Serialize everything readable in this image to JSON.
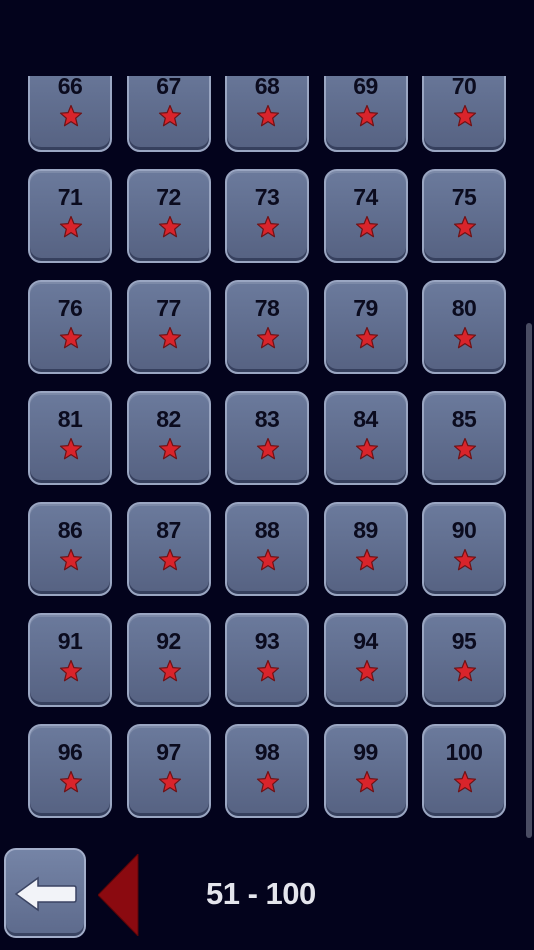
{
  "levels": [
    {
      "number": "66",
      "stars": 1
    },
    {
      "number": "67",
      "stars": 1
    },
    {
      "number": "68",
      "stars": 1
    },
    {
      "number": "69",
      "stars": 1
    },
    {
      "number": "70",
      "stars": 1
    },
    {
      "number": "71",
      "stars": 1
    },
    {
      "number": "72",
      "stars": 1
    },
    {
      "number": "73",
      "stars": 1
    },
    {
      "number": "74",
      "stars": 1
    },
    {
      "number": "75",
      "stars": 1
    },
    {
      "number": "76",
      "stars": 1
    },
    {
      "number": "77",
      "stars": 1
    },
    {
      "number": "78",
      "stars": 1
    },
    {
      "number": "79",
      "stars": 1
    },
    {
      "number": "80",
      "stars": 1
    },
    {
      "number": "81",
      "stars": 1
    },
    {
      "number": "82",
      "stars": 1
    },
    {
      "number": "83",
      "stars": 1
    },
    {
      "number": "84",
      "stars": 1
    },
    {
      "number": "85",
      "stars": 1
    },
    {
      "number": "86",
      "stars": 1
    },
    {
      "number": "87",
      "stars": 1
    },
    {
      "number": "88",
      "stars": 1
    },
    {
      "number": "89",
      "stars": 1
    },
    {
      "number": "90",
      "stars": 1
    },
    {
      "number": "91",
      "stars": 1
    },
    {
      "number": "92",
      "stars": 1
    },
    {
      "number": "93",
      "stars": 1
    },
    {
      "number": "94",
      "stars": 1
    },
    {
      "number": "95",
      "stars": 1
    },
    {
      "number": "96",
      "stars": 1
    },
    {
      "number": "97",
      "stars": 1
    },
    {
      "number": "98",
      "stars": 1
    },
    {
      "number": "99",
      "stars": 1
    },
    {
      "number": "100",
      "stars": 1
    }
  ],
  "footer": {
    "page_range": "51 - 100",
    "back_icon": "left-arrow-icon",
    "prev_icon": "triangle-left-icon"
  },
  "colors": {
    "background": "#03031c",
    "tile": "#616e90",
    "tile_border": "#9aa6c2",
    "star": "#d9242b",
    "star_outline": "#6e1216",
    "number": "#0b0b1e",
    "prev_arrow": "#8b0a10",
    "page_range_text": "#e4e5ec"
  }
}
